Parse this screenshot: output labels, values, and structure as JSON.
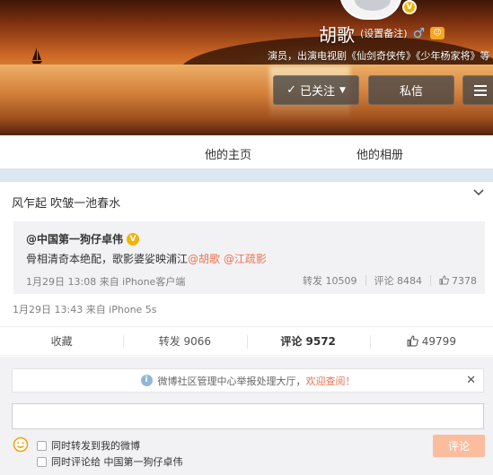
{
  "profile": {
    "name": "胡歌",
    "remark": "(设置备注)",
    "gender_symbol": "♂",
    "verified_badge": "V",
    "description": "演员，出演电视剧《仙剑奇侠传》《少年杨家将》等"
  },
  "buttons": {
    "follow": "已关注",
    "message": "私信"
  },
  "tabs": {
    "home": "他的主页",
    "album": "他的相册"
  },
  "post": {
    "text": "风乍起 吹皱一池春水",
    "meta": "1月29日 13:43 来自 iPhone 5s",
    "retweeted": {
      "user": "@中国第一狗仔卓伟",
      "text_prefix": "骨相清奇本绝配，歌影婆娑映浦江",
      "mention_1": "@胡歌",
      "mention_2": "@江疏影",
      "meta": "1月29日 13:08 来自 iPhone客户端",
      "repost_label": "转发 10509",
      "comment_label": "评论 8484",
      "like_count": "7378"
    }
  },
  "actions": {
    "favorite": "收藏",
    "repost": "转发 9066",
    "comment": "评论 9572",
    "like": "49799"
  },
  "comment_box": {
    "notice_text": "微博社区管理中心举报处理大厅，",
    "notice_link": "欢迎查阅！",
    "input_value": "",
    "option_repost": "同时转发到我的微博",
    "option_comment": "同时评论给 中国第一狗仔卓伟",
    "submit": "评论"
  },
  "colors": {
    "accent": "#eb7350",
    "submit_disabled": "#fbbd9e",
    "verified": "#f2b400"
  }
}
